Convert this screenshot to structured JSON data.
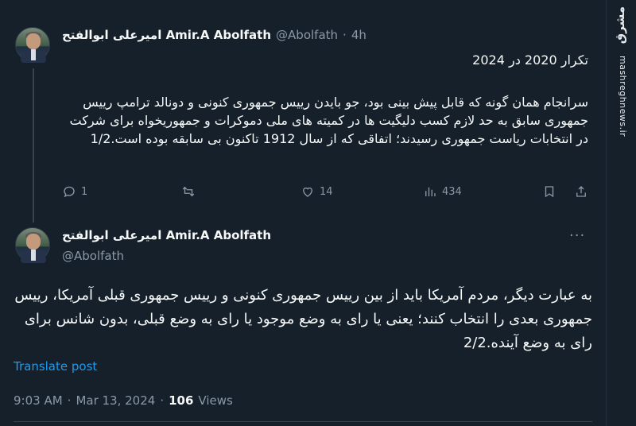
{
  "tweet1": {
    "display_name": "امیرعلی ابوالفتح Amir.A Abolfath",
    "handle": "@Abolfath",
    "separator": "·",
    "time": "4h",
    "title_line": "تکرار 2020 در 2024",
    "body": "سرانجام همان گونه که قابل پیش بینی بود، جو بایدن رییس جمهوری کنونی و دونالد ترامپ رییس جمهوری سابق به حد لازم کسب دلیگیت ها در کمیته های ملی دموکرات و جمهوریخواه برای شرکت در انتخابات ریاست جمهوری رسیدند؛ اتفاقی که از سال 1912 تاکنون بی سابقه بوده است.1/2",
    "replies": "1",
    "likes": "14",
    "views": "434"
  },
  "tweet2": {
    "display_name": "امیرعلی ابوالفتح Amir.A Abolfath",
    "handle": "@Abolfath",
    "body": "به عبارت دیگر، مردم آمریکا باید از بین رییس جمهوری کنونی و رییس جمهوری قبلی آمریکا، رییس جمهوری بعدی را انتخاب کنند؛ یعنی یا رای به وضع موجود یا رای به وضع قبلی، بدون شانس برای رای به وضع آینده.2/2",
    "translate": "Translate post",
    "time": "9:03 AM",
    "date": "Mar 13, 2024",
    "views_count": "106",
    "views_label": "Views"
  },
  "watermark": {
    "logo": "مشرق",
    "url": "mashreghnews.ir"
  },
  "colors": {
    "background": "#15202b",
    "text": "#f7f9f9",
    "muted": "#8b98a5",
    "accent": "#1d9bf0",
    "divider": "#38444d"
  }
}
